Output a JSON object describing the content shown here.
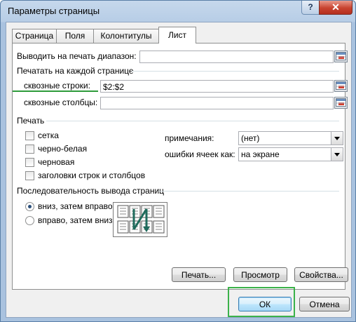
{
  "window": {
    "title": "Параметры страницы",
    "help_label": "?",
    "close_label": "✕"
  },
  "tabs": [
    {
      "label": "Страница",
      "active": false
    },
    {
      "label": "Поля",
      "active": false
    },
    {
      "label": "Колонтитулы",
      "active": false
    },
    {
      "label": "Лист",
      "active": true
    }
  ],
  "print_area": {
    "label": "Выводить на печать диапазон:",
    "value": ""
  },
  "print_titles": {
    "group_label": "Печатать на каждой странице",
    "rows_label": "сквозные строки:",
    "rows_value": "$2:$2",
    "cols_label": "сквозные столбцы:",
    "cols_value": ""
  },
  "print": {
    "group_label": "Печать",
    "checkboxes": [
      {
        "label": "сетка",
        "checked": false
      },
      {
        "label": "черно-белая",
        "checked": false
      },
      {
        "label": "черновая",
        "checked": false
      },
      {
        "label": "заголовки строк и столбцов",
        "checked": false
      }
    ],
    "comments_label": "примечания:",
    "comments_value": "(нет)",
    "errors_label": "ошибки ячеек как:",
    "errors_value": "на экране"
  },
  "page_order": {
    "group_label": "Последовательность вывода страниц",
    "options": [
      {
        "label": "вниз, затем вправо",
        "checked": true
      },
      {
        "label": "вправо, затем вниз",
        "checked": false
      }
    ]
  },
  "buttons": {
    "print": "Печать...",
    "preview": "Просмотр",
    "properties": "Свойства...",
    "ok": "ОК",
    "cancel": "Отмена"
  },
  "colors": {
    "highlight": "#3bb24a",
    "title_bar": "#b7cde6",
    "close_button": "#c84330"
  }
}
